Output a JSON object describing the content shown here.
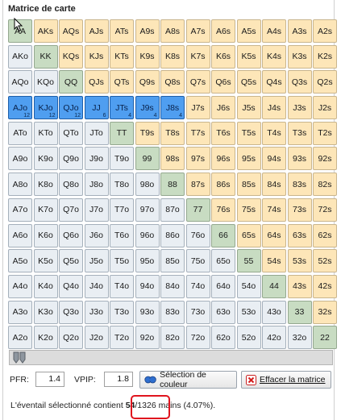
{
  "panel": {
    "title": "Matrice de carte"
  },
  "matrix": {
    "rows": [
      [
        {
          "l": "AA",
          "t": "pair"
        },
        {
          "l": "AKs",
          "t": "suited"
        },
        {
          "l": "AQs",
          "t": "suited"
        },
        {
          "l": "AJs",
          "t": "suited"
        },
        {
          "l": "ATs",
          "t": "suited"
        },
        {
          "l": "A9s",
          "t": "suited"
        },
        {
          "l": "A8s",
          "t": "suited"
        },
        {
          "l": "A7s",
          "t": "suited"
        },
        {
          "l": "A6s",
          "t": "suited"
        },
        {
          "l": "A5s",
          "t": "suited"
        },
        {
          "l": "A4s",
          "t": "suited"
        },
        {
          "l": "A3s",
          "t": "suited"
        },
        {
          "l": "A2s",
          "t": "suited"
        }
      ],
      [
        {
          "l": "AKo",
          "t": "offsuit"
        },
        {
          "l": "KK",
          "t": "pair"
        },
        {
          "l": "KQs",
          "t": "suited"
        },
        {
          "l": "KJs",
          "t": "suited"
        },
        {
          "l": "KTs",
          "t": "suited"
        },
        {
          "l": "K9s",
          "t": "suited"
        },
        {
          "l": "K8s",
          "t": "suited"
        },
        {
          "l": "K7s",
          "t": "suited"
        },
        {
          "l": "K6s",
          "t": "suited"
        },
        {
          "l": "K5s",
          "t": "suited"
        },
        {
          "l": "K4s",
          "t": "suited"
        },
        {
          "l": "K3s",
          "t": "suited"
        },
        {
          "l": "K2s",
          "t": "suited"
        }
      ],
      [
        {
          "l": "AQo",
          "t": "offsuit"
        },
        {
          "l": "KQo",
          "t": "offsuit"
        },
        {
          "l": "QQ",
          "t": "pair"
        },
        {
          "l": "QJs",
          "t": "suited"
        },
        {
          "l": "QTs",
          "t": "suited"
        },
        {
          "l": "Q9s",
          "t": "suited"
        },
        {
          "l": "Q8s",
          "t": "suited"
        },
        {
          "l": "Q7s",
          "t": "suited"
        },
        {
          "l": "Q6s",
          "t": "suited"
        },
        {
          "l": "Q5s",
          "t": "suited"
        },
        {
          "l": "Q4s",
          "t": "suited"
        },
        {
          "l": "Q3s",
          "t": "suited"
        },
        {
          "l": "Q2s",
          "t": "suited"
        }
      ],
      [
        {
          "l": "AJo",
          "t": "sel",
          "c": "12"
        },
        {
          "l": "KJo",
          "t": "sel",
          "c": "12"
        },
        {
          "l": "QJo",
          "t": "sel",
          "c": "12"
        },
        {
          "l": "JJ",
          "t": "sel",
          "c": "6"
        },
        {
          "l": "JTs",
          "t": "sel",
          "c": "4"
        },
        {
          "l": "J9s",
          "t": "sel",
          "c": "4"
        },
        {
          "l": "J8s",
          "t": "sel",
          "c": "4"
        },
        {
          "l": "J7s",
          "t": "suited"
        },
        {
          "l": "J6s",
          "t": "suited"
        },
        {
          "l": "J5s",
          "t": "suited"
        },
        {
          "l": "J4s",
          "t": "suited"
        },
        {
          "l": "J3s",
          "t": "suited"
        },
        {
          "l": "J2s",
          "t": "suited"
        }
      ],
      [
        {
          "l": "ATo",
          "t": "offsuit"
        },
        {
          "l": "KTo",
          "t": "offsuit"
        },
        {
          "l": "QTo",
          "t": "offsuit"
        },
        {
          "l": "JTo",
          "t": "offsuit"
        },
        {
          "l": "TT",
          "t": "pair"
        },
        {
          "l": "T9s",
          "t": "suited"
        },
        {
          "l": "T8s",
          "t": "suited"
        },
        {
          "l": "T7s",
          "t": "suited"
        },
        {
          "l": "T6s",
          "t": "suited"
        },
        {
          "l": "T5s",
          "t": "suited"
        },
        {
          "l": "T4s",
          "t": "suited"
        },
        {
          "l": "T3s",
          "t": "suited"
        },
        {
          "l": "T2s",
          "t": "suited"
        }
      ],
      [
        {
          "l": "A9o",
          "t": "offsuit"
        },
        {
          "l": "K9o",
          "t": "offsuit"
        },
        {
          "l": "Q9o",
          "t": "offsuit"
        },
        {
          "l": "J9o",
          "t": "offsuit"
        },
        {
          "l": "T9o",
          "t": "offsuit"
        },
        {
          "l": "99",
          "t": "pair"
        },
        {
          "l": "98s",
          "t": "suited"
        },
        {
          "l": "97s",
          "t": "suited"
        },
        {
          "l": "96s",
          "t": "suited"
        },
        {
          "l": "95s",
          "t": "suited"
        },
        {
          "l": "94s",
          "t": "suited"
        },
        {
          "l": "93s",
          "t": "suited"
        },
        {
          "l": "92s",
          "t": "suited"
        }
      ],
      [
        {
          "l": "A8o",
          "t": "offsuit"
        },
        {
          "l": "K8o",
          "t": "offsuit"
        },
        {
          "l": "Q8o",
          "t": "offsuit"
        },
        {
          "l": "J8o",
          "t": "offsuit"
        },
        {
          "l": "T8o",
          "t": "offsuit"
        },
        {
          "l": "98o",
          "t": "offsuit"
        },
        {
          "l": "88",
          "t": "pair"
        },
        {
          "l": "87s",
          "t": "suited"
        },
        {
          "l": "86s",
          "t": "suited"
        },
        {
          "l": "85s",
          "t": "suited"
        },
        {
          "l": "84s",
          "t": "suited"
        },
        {
          "l": "83s",
          "t": "suited"
        },
        {
          "l": "82s",
          "t": "suited"
        }
      ],
      [
        {
          "l": "A7o",
          "t": "offsuit"
        },
        {
          "l": "K7o",
          "t": "offsuit"
        },
        {
          "l": "Q7o",
          "t": "offsuit"
        },
        {
          "l": "J7o",
          "t": "offsuit"
        },
        {
          "l": "T7o",
          "t": "offsuit"
        },
        {
          "l": "97o",
          "t": "offsuit"
        },
        {
          "l": "87o",
          "t": "offsuit"
        },
        {
          "l": "77",
          "t": "pair"
        },
        {
          "l": "76s",
          "t": "suited"
        },
        {
          "l": "75s",
          "t": "suited"
        },
        {
          "l": "74s",
          "t": "suited"
        },
        {
          "l": "73s",
          "t": "suited"
        },
        {
          "l": "72s",
          "t": "suited"
        }
      ],
      [
        {
          "l": "A6o",
          "t": "offsuit"
        },
        {
          "l": "K6o",
          "t": "offsuit"
        },
        {
          "l": "Q6o",
          "t": "offsuit"
        },
        {
          "l": "J6o",
          "t": "offsuit"
        },
        {
          "l": "T6o",
          "t": "offsuit"
        },
        {
          "l": "96o",
          "t": "offsuit"
        },
        {
          "l": "86o",
          "t": "offsuit"
        },
        {
          "l": "76o",
          "t": "offsuit"
        },
        {
          "l": "66",
          "t": "pair"
        },
        {
          "l": "65s",
          "t": "suited"
        },
        {
          "l": "64s",
          "t": "suited"
        },
        {
          "l": "63s",
          "t": "suited"
        },
        {
          "l": "62s",
          "t": "suited"
        }
      ],
      [
        {
          "l": "A5o",
          "t": "offsuit"
        },
        {
          "l": "K5o",
          "t": "offsuit"
        },
        {
          "l": "Q5o",
          "t": "offsuit"
        },
        {
          "l": "J5o",
          "t": "offsuit"
        },
        {
          "l": "T5o",
          "t": "offsuit"
        },
        {
          "l": "95o",
          "t": "offsuit"
        },
        {
          "l": "85o",
          "t": "offsuit"
        },
        {
          "l": "75o",
          "t": "offsuit"
        },
        {
          "l": "65o",
          "t": "offsuit"
        },
        {
          "l": "55",
          "t": "pair"
        },
        {
          "l": "54s",
          "t": "suited"
        },
        {
          "l": "53s",
          "t": "suited"
        },
        {
          "l": "52s",
          "t": "suited"
        }
      ],
      [
        {
          "l": "A4o",
          "t": "offsuit"
        },
        {
          "l": "K4o",
          "t": "offsuit"
        },
        {
          "l": "Q4o",
          "t": "offsuit"
        },
        {
          "l": "J4o",
          "t": "offsuit"
        },
        {
          "l": "T4o",
          "t": "offsuit"
        },
        {
          "l": "94o",
          "t": "offsuit"
        },
        {
          "l": "84o",
          "t": "offsuit"
        },
        {
          "l": "74o",
          "t": "offsuit"
        },
        {
          "l": "64o",
          "t": "offsuit"
        },
        {
          "l": "54o",
          "t": "offsuit"
        },
        {
          "l": "44",
          "t": "pair"
        },
        {
          "l": "43s",
          "t": "suited"
        },
        {
          "l": "42s",
          "t": "suited"
        }
      ],
      [
        {
          "l": "A3o",
          "t": "offsuit"
        },
        {
          "l": "K3o",
          "t": "offsuit"
        },
        {
          "l": "Q3o",
          "t": "offsuit"
        },
        {
          "l": "J3o",
          "t": "offsuit"
        },
        {
          "l": "T3o",
          "t": "offsuit"
        },
        {
          "l": "93o",
          "t": "offsuit"
        },
        {
          "l": "83o",
          "t": "offsuit"
        },
        {
          "l": "73o",
          "t": "offsuit"
        },
        {
          "l": "63o",
          "t": "offsuit"
        },
        {
          "l": "53o",
          "t": "offsuit"
        },
        {
          "l": "43o",
          "t": "offsuit"
        },
        {
          "l": "33",
          "t": "pair"
        },
        {
          "l": "32s",
          "t": "suited"
        }
      ],
      [
        {
          "l": "A2o",
          "t": "offsuit"
        },
        {
          "l": "K2o",
          "t": "offsuit"
        },
        {
          "l": "Q2o",
          "t": "offsuit"
        },
        {
          "l": "J2o",
          "t": "offsuit"
        },
        {
          "l": "T2o",
          "t": "offsuit"
        },
        {
          "l": "92o",
          "t": "offsuit"
        },
        {
          "l": "82o",
          "t": "offsuit"
        },
        {
          "l": "72o",
          "t": "offsuit"
        },
        {
          "l": "62o",
          "t": "offsuit"
        },
        {
          "l": "52o",
          "t": "offsuit"
        },
        {
          "l": "42o",
          "t": "offsuit"
        },
        {
          "l": "32o",
          "t": "offsuit"
        },
        {
          "l": "22",
          "t": "pair"
        }
      ]
    ]
  },
  "controls": {
    "pfr_label": "PFR:",
    "pfr_value": "1.4",
    "vpip_label": "VPIP:",
    "vpip_value": "1.8",
    "color_button_label": "Sélection de couleur",
    "clear_button_label": "Effacer la matrice"
  },
  "summary": {
    "prefix": "L'éventail sélectionné contient ",
    "selected": "54",
    "separator": "/",
    "total": "1326",
    "suffix": " mains (4.07%)."
  },
  "colors": {
    "suited": "#fde6b8",
    "offsuit": "#e9eef3",
    "pair": "#c8dcc2",
    "selected": "#4f9ef0",
    "highlight": "#e0141e"
  },
  "icons": {
    "cursor": "mouse-cursor-icon",
    "slider": "slider-thumb-icon",
    "color": "color-palette-icon",
    "clear": "clear-x-icon"
  }
}
